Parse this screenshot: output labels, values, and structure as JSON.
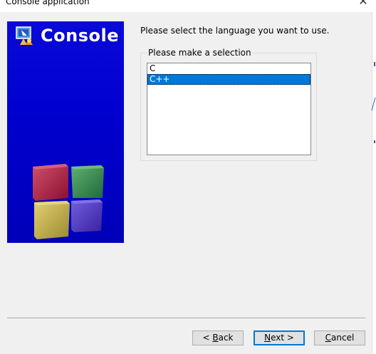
{
  "window": {
    "title": "Console application",
    "close_glyph": "✕"
  },
  "banner": {
    "title": "Console",
    "logo_icon": "codeblocks-wizard-icon",
    "art_icon": "colored-cubes-icon",
    "background_color": "#0000d0"
  },
  "page": {
    "instruction": "Please select the language you want to use.",
    "group_label": "Please make a selection",
    "languages": [
      "C",
      "C++"
    ],
    "selected_language": "C++"
  },
  "buttons": {
    "back": {
      "before": "< ",
      "accel": "B",
      "after": "ack"
    },
    "next": {
      "before": "",
      "accel": "N",
      "after": "ext >"
    },
    "cancel": {
      "before": "",
      "accel": "C",
      "after": "ancel"
    }
  },
  "colors": {
    "selection": "#0078d7",
    "default_button_border": "#0078d7"
  }
}
